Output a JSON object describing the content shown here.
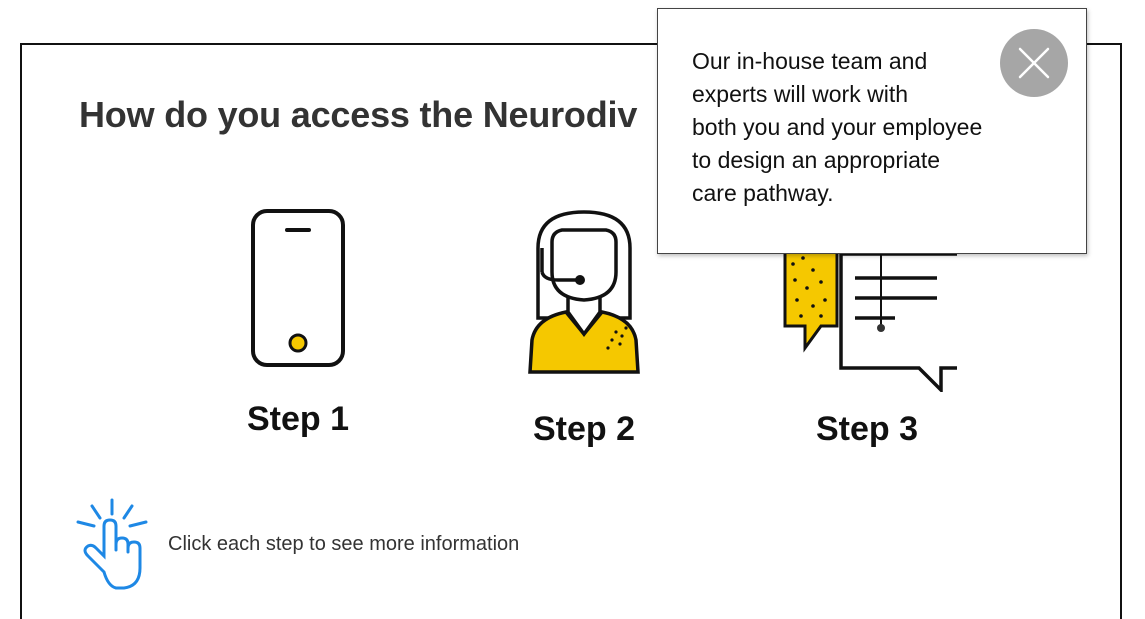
{
  "heading": "How do you access the Neurodiv",
  "steps": [
    {
      "label": "Step 1",
      "icon": "smartphone-icon"
    },
    {
      "label": "Step 2",
      "icon": "headset-operator-icon"
    },
    {
      "label": "Step 3",
      "icon": "speech-bubbles-icon"
    }
  ],
  "hint": {
    "text": "Click each step to see more information",
    "icon": "tap-hand-icon"
  },
  "tooltip": {
    "lines": [
      "Our in-house team and",
      "experts will work with",
      "both you and your employee",
      "to design an appropriate",
      "care pathway."
    ],
    "close_icon": "close-icon"
  },
  "colors": {
    "accent_yellow": "#F5C800",
    "hint_blue": "#1E88E5",
    "close_grey": "#A6A6A6",
    "text_dark": "#111111"
  }
}
